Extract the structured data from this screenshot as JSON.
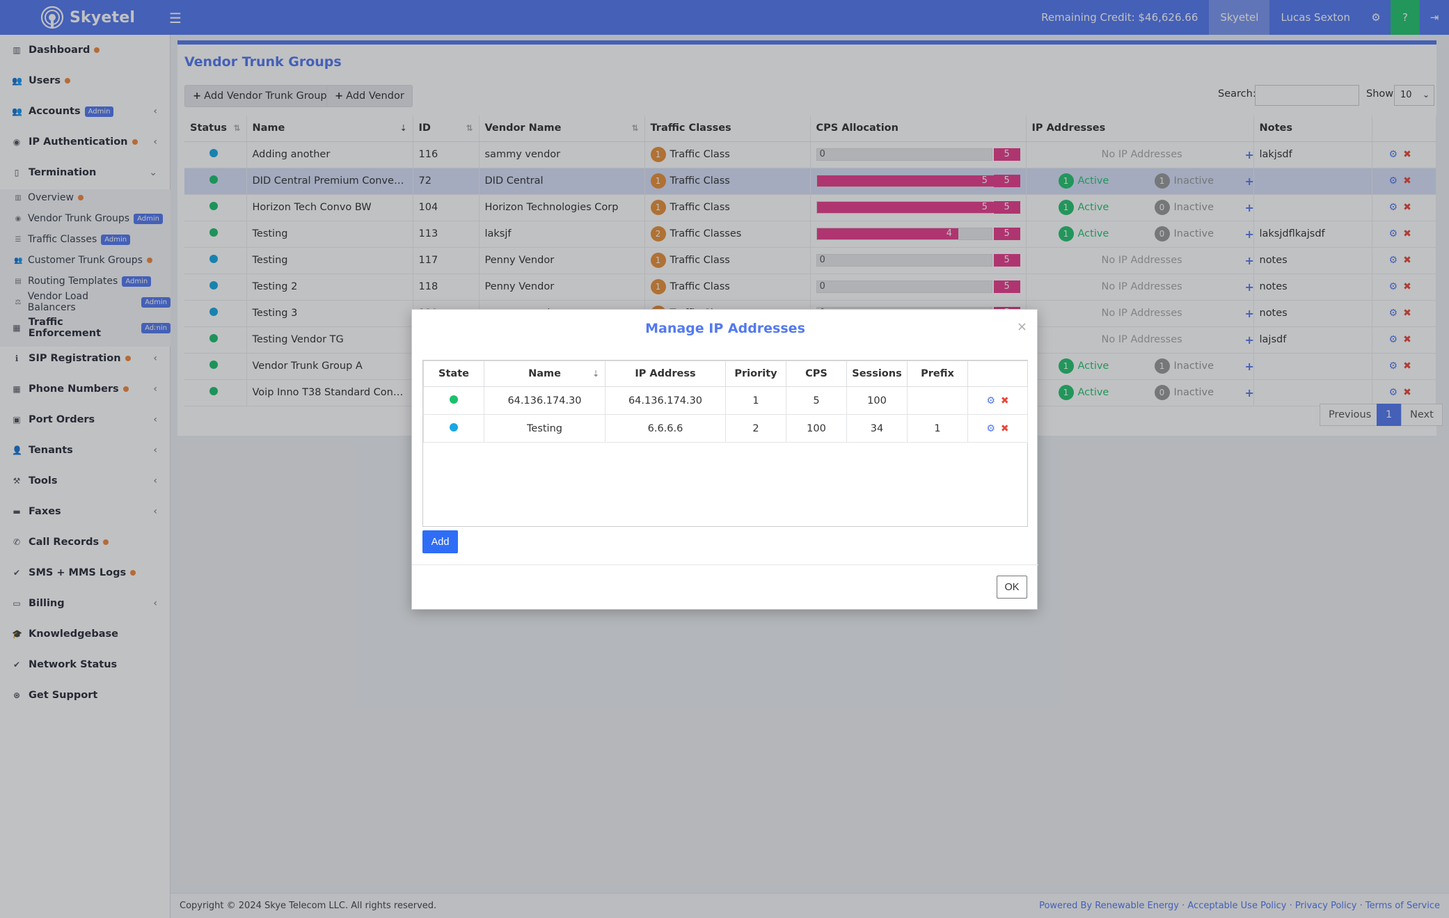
{
  "brand": {
    "name": "Skyetel"
  },
  "topbar": {
    "credit": "Remaining Credit: $46,626.66",
    "org": "Skyetel",
    "user": "Lucas Sexton",
    "help": "?"
  },
  "sidebar": {
    "items": [
      {
        "label": "Dashboard"
      },
      {
        "label": "Users"
      },
      {
        "label": "Accounts",
        "badge": "Admin"
      },
      {
        "label": "IP Authentication"
      },
      {
        "label": "Termination"
      },
      {
        "label": "Traffic Enforcement",
        "badge": "Admin"
      },
      {
        "label": "SIP Registration"
      },
      {
        "label": "Phone Numbers"
      },
      {
        "label": "Port Orders"
      },
      {
        "label": "Tenants"
      },
      {
        "label": "Tools"
      },
      {
        "label": "Faxes"
      },
      {
        "label": "Call Records"
      },
      {
        "label": "SMS + MMS Logs"
      },
      {
        "label": "Billing"
      },
      {
        "label": "Knowledgebase"
      },
      {
        "label": "Network Status"
      },
      {
        "label": "Get Support"
      }
    ],
    "sub_items": [
      {
        "label": "Overview"
      },
      {
        "label": "Vendor Trunk Groups",
        "badge": "Admin"
      },
      {
        "label": "Traffic Classes",
        "badge": "Admin"
      },
      {
        "label": "Customer Trunk Groups"
      },
      {
        "label": "Routing Templates",
        "badge": "Admin"
      },
      {
        "label": "Vendor Load Balancers",
        "badge": "Admin"
      }
    ]
  },
  "page": {
    "title": "Vendor Trunk Groups",
    "add_group_label": "Add Vendor Trunk Group",
    "add_vendor_label": "Add Vendor",
    "search_label": "Search:",
    "show_label": "Show",
    "show_value": "10"
  },
  "table": {
    "headers": [
      "Status",
      "Name",
      "ID",
      "Vendor Name",
      "Traffic Classes",
      "CPS Allocation",
      "IP Addresses",
      "Notes"
    ],
    "rows": [
      {
        "status": "#17a8e3",
        "name": "Adding another",
        "id": "116",
        "vendor": "sammy vendor",
        "tc_count": "1",
        "tc_label": "Traffic Class",
        "cps": "0",
        "cps_max": "5",
        "ip": "No IP Addresses",
        "notes": "lakjsdf"
      },
      {
        "status": "#1cc06e",
        "name": "DID Central Premium Conversati...",
        "id": "72",
        "vendor": "DID Central",
        "tc_count": "1",
        "tc_label": "Traffic Class",
        "cps": "5",
        "cps_max": "5",
        "active": "1",
        "active_label": "Active",
        "inactive": "1",
        "inactive_label": "Inactive",
        "notes": ""
      },
      {
        "status": "#1cc06e",
        "name": "Horizon Tech Convo BW",
        "id": "104",
        "vendor": "Horizon Technologies Corp",
        "tc_count": "1",
        "tc_label": "Traffic Class",
        "cps": "5",
        "cps_max": "5",
        "active": "1",
        "active_label": "Active",
        "inactive": "0",
        "inactive_label": "Inactive",
        "notes": ""
      },
      {
        "status": "#1cc06e",
        "name": "Testing",
        "id": "113",
        "vendor": "laksjf",
        "tc_count": "2",
        "tc_label": "Traffic Classes",
        "cps": "4",
        "cps_max": "5",
        "active": "1",
        "active_label": "Active",
        "inactive": "0",
        "inactive_label": "Inactive",
        "notes": "laksjdflkajsdf"
      },
      {
        "status": "#17a8e3",
        "name": "Testing",
        "id": "117",
        "vendor": "Penny Vendor",
        "tc_count": "1",
        "tc_label": "Traffic Class",
        "cps": "0",
        "cps_max": "5",
        "ip": "No IP Addresses",
        "notes": "notes"
      },
      {
        "status": "#17a8e3",
        "name": "Testing 2",
        "id": "118",
        "vendor": "Penny Vendor",
        "tc_count": "1",
        "tc_label": "Traffic Class",
        "cps": "0",
        "cps_max": "5",
        "ip": "No IP Addresses",
        "notes": "notes"
      },
      {
        "status": "#17a8e3",
        "name": "Testing 3",
        "id": "119",
        "vendor": "sammy vendor",
        "tc_count": "1",
        "tc_label": "Traffic Class",
        "cps": "0",
        "cps_max": "5",
        "ip": "No IP Addresses",
        "notes": "notes"
      },
      {
        "status": "#1cc06e",
        "name": "Testing Vendor TG",
        "id": "",
        "vendor": "",
        "tc_count": "",
        "tc_label": "",
        "cps": "",
        "cps_max": "",
        "ip": "No IP Addresses",
        "notes": "lajsdf"
      },
      {
        "status": "#1cc06e",
        "name": "Vendor Trunk Group A",
        "id": "",
        "vendor": "",
        "tc_count": "",
        "tc_label": "",
        "cps": "",
        "cps_max": "",
        "active": "1",
        "active_label": "Active",
        "inactive": "1",
        "inactive_label": "Inactive",
        "notes": ""
      },
      {
        "status": "#1cc06e",
        "name": "Voip Inno T38 Standard Convers...",
        "id": "",
        "vendor": "",
        "tc_count": "",
        "tc_label": "",
        "cps": "",
        "cps_max": "",
        "active": "1",
        "active_label": "Active",
        "inactive": "0",
        "inactive_label": "Inactive",
        "notes": ""
      }
    ]
  },
  "pagination": {
    "previous": "Previous",
    "current": "1",
    "next": "Next"
  },
  "footer": {
    "copyright": "Copyright © 2024 Skye Telecom LLC. All rights reserved.",
    "links": "Powered By Renewable Energy · Acceptable Use Policy · Privacy Policy · Terms of Service"
  },
  "modal": {
    "title": "Manage IP Addresses",
    "close": "×",
    "headers": [
      "State",
      "Name",
      "IP Address",
      "Priority",
      "CPS",
      "Sessions",
      "Prefix"
    ],
    "rows": [
      {
        "state": "#1cc06e",
        "name": "64.136.174.30",
        "ip": "64.136.174.30",
        "priority": "1",
        "cps": "5",
        "sessions": "100",
        "prefix": ""
      },
      {
        "state": "#17a8e3",
        "name": "Testing",
        "ip": "6.6.6.6",
        "priority": "2",
        "cps": "100",
        "sessions": "34",
        "prefix": "1"
      }
    ],
    "add_label": "Add",
    "ok_label": "OK"
  },
  "colors": {
    "accent": "#5479ef",
    "pink": "#e83e8c",
    "orange": "#e8913a",
    "green": "#25c470"
  }
}
